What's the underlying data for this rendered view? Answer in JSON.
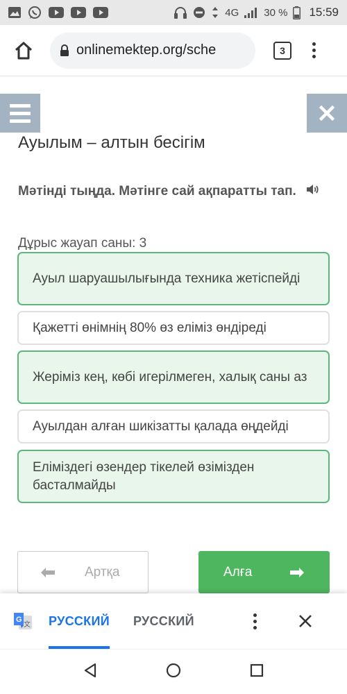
{
  "status_bar": {
    "network": "4G",
    "battery": "30 %",
    "time": "15:59",
    "icons": [
      "image-icon",
      "whatsapp-icon",
      "youtube-icon",
      "youtube-icon",
      "youtube-icon",
      "headphones-icon",
      "dnd-icon",
      "data-arrows-icon",
      "signal-icon",
      "battery-icon"
    ]
  },
  "browser": {
    "url": "onlinemektep.org/sche",
    "tab_count": "3"
  },
  "page": {
    "title": "Ауылым – алтын бесігім",
    "instruction": "Мәтінді тыңда. Мәтінге сай ақпаратты тап.",
    "correct_count_label": "Дұрыс жауап саны: 3",
    "options": [
      {
        "text": "Ауыл шаруашылығында техника жетіспейді",
        "selected": true
      },
      {
        "text": "Қажетті өнімнің 80% өз еліміз өндіреді",
        "selected": false
      },
      {
        "text": "Жеріміз кең, көбі игерілмеген, халық саны аз",
        "selected": true
      },
      {
        "text": "Ауылдан алған шикізатты қалада өңдейді",
        "selected": false
      },
      {
        "text": "Елімізде­гі өзендер тікелей өзімізден басталмайды",
        "selected": true
      }
    ],
    "back_label": "Артқа",
    "next_label": "Алға"
  },
  "translate_bar": {
    "lang_active": "РУССКИЙ",
    "lang_inactive": "РУССКИЙ"
  },
  "colors": {
    "selected_bg": "#e9f6ec",
    "selected_border": "#5bb77a",
    "next_button": "#4fb660",
    "nav_button_bg": "#a3b3c1",
    "translate_accent": "#1a73e8"
  }
}
